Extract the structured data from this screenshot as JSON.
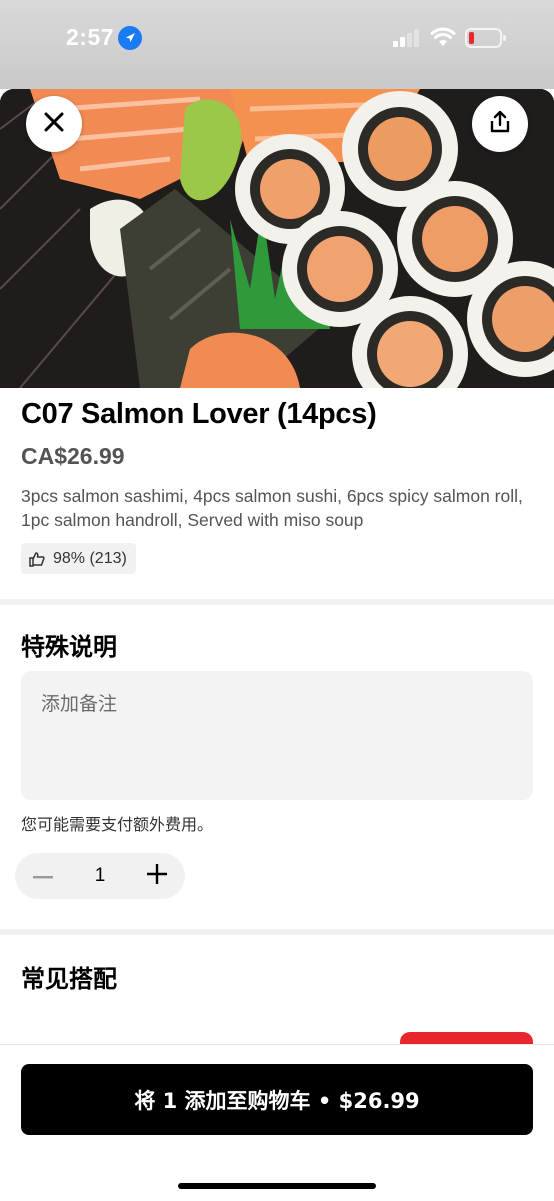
{
  "status_bar": {
    "time": "2:57"
  },
  "item": {
    "title": "C07 Salmon Lover (14pcs)",
    "price": "CA$26.99",
    "description": "3pcs salmon sashimi, 4pcs salmon sushi, 6pcs spicy salmon roll, 1pc salmon handroll, Served with miso soup",
    "rating": "98% (213)"
  },
  "special_instructions": {
    "heading": "特殊说明",
    "placeholder": "添加备注",
    "fee_note": "您可能需要支付额外费用。"
  },
  "quantity": {
    "value": "1"
  },
  "pairings": {
    "heading": "常见搭配"
  },
  "cart_button": {
    "label": "将 1 添加至购物车 • $26.99"
  },
  "icons": {
    "close": "close-icon",
    "share": "share-icon",
    "thumbs_up": "thumbs-up-icon",
    "minus": "minus-icon",
    "plus": "plus-icon",
    "location": "location-arrow-icon",
    "signal": "cellular-signal-icon",
    "wifi": "wifi-icon",
    "battery": "battery-low-icon"
  },
  "colors": {
    "primary_button": "#000000",
    "accent_red": "#e8262d",
    "battery_low": "#e8262d"
  }
}
